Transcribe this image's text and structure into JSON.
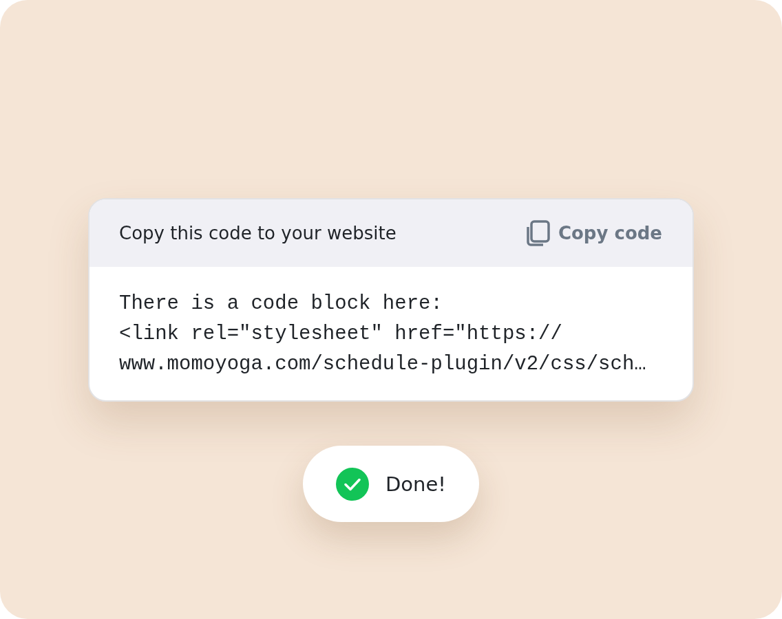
{
  "code_card": {
    "title": "Copy this code to your website",
    "copy_button": {
      "label": "Copy code"
    },
    "code_lines": [
      "There is a code block here:",
      "<link rel=\"stylesheet\" href=\"https://",
      "www.momoyoga.com/schedule-plugin/v2/css/sch…"
    ]
  },
  "toast": {
    "message": "Done!"
  }
}
